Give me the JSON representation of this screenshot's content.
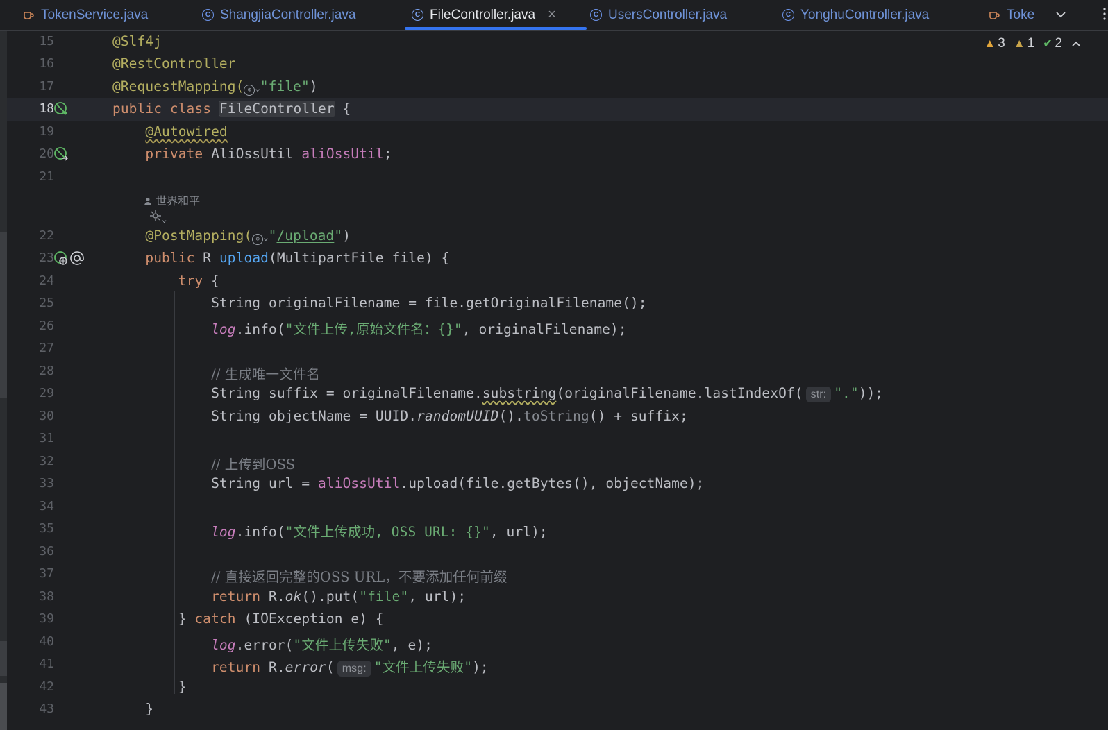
{
  "tabs": [
    {
      "label": "TokenService.java",
      "icon": "java-cup-icon",
      "active": false
    },
    {
      "label": "ShangjiaController.java",
      "icon": "class-c-icon",
      "active": false
    },
    {
      "label": "FileController.java",
      "icon": "class-c-icon",
      "active": true
    },
    {
      "label": "UsersController.java",
      "icon": "class-c-icon",
      "active": false
    },
    {
      "label": "YonghuController.java",
      "icon": "class-c-icon",
      "active": false
    },
    {
      "label": "Toke",
      "icon": "java-cup-icon",
      "active": false
    }
  ],
  "inspections": {
    "warnings": "3",
    "weak_warnings": "1",
    "typos": "2"
  },
  "author_hint": "世界和平",
  "code": {
    "l15": {
      "n": "15",
      "ann": "@Slf4j"
    },
    "l16": {
      "n": "16",
      "ann": "@RestController"
    },
    "l17": {
      "n": "17",
      "ann": "@RequestMapping(",
      "str": "\"file\"",
      "close": ")"
    },
    "l18": {
      "n": "18",
      "kw": "public class ",
      "cls": "FileController",
      "rest": " {"
    },
    "l19": {
      "n": "19",
      "ann": "@Autowired"
    },
    "l20": {
      "n": "20",
      "kw": "private ",
      "type": "AliOssUtil ",
      "field": "aliOssUtil",
      "rest": ";"
    },
    "l21": {
      "n": "21"
    },
    "l22": {
      "n": "22",
      "ann": "@PostMapping(",
      "str_q1": "\"",
      "str_path": "/upload",
      "str_q2": "\"",
      "close": ")"
    },
    "l23": {
      "n": "23",
      "kw": "public ",
      "type": "R ",
      "fn": "upload",
      "rest": "(MultipartFile file) {"
    },
    "l24": {
      "n": "24",
      "kw": "try",
      "rest": " {"
    },
    "l25": {
      "n": "25",
      "text": "String originalFilename = file.getOriginalFilename();"
    },
    "l26": {
      "n": "26",
      "st": "log",
      "pre": ".info(",
      "str": "\"文件上传,原始文件名：{}\"",
      "post": ", originalFilename);"
    },
    "l27": {
      "n": "27"
    },
    "l28": {
      "n": "28",
      "comment": "// 生成唯一文件名"
    },
    "l29": {
      "n": "29",
      "pre": "String suffix = originalFilename.",
      "wavy": "substring",
      "mid": "(originalFilename.lastIndexOf(",
      "hint": "str:",
      "str": "\".\"",
      "post": "));"
    },
    "l30": {
      "n": "30",
      "pre": "String objectName = UUID.",
      "it": "randomUUID",
      "mid": "().",
      "muted": "toString",
      "post": "() + suffix;"
    },
    "l31": {
      "n": "31"
    },
    "l32": {
      "n": "32",
      "comment": "// 上传到OSS"
    },
    "l33": {
      "n": "33",
      "pre": "String url = ",
      "field": "aliOssUtil",
      "post": ".upload(file.getBytes(), objectName);"
    },
    "l34": {
      "n": "34"
    },
    "l35": {
      "n": "35",
      "st": "log",
      "pre": ".info(",
      "str": "\"文件上传成功, OSS URL: {}\"",
      "post": ", url);"
    },
    "l36": {
      "n": "36"
    },
    "l37": {
      "n": "37",
      "comment": "// 直接返回完整的OSS URL，不要添加任何前缀"
    },
    "l38": {
      "n": "38",
      "kw": "return ",
      "pre": "R.",
      "it": "ok",
      "mid": "().put(",
      "str": "\"file\"",
      "post": ", url);"
    },
    "l39": {
      "n": "39",
      "pre": "} ",
      "kw": "catch",
      "post": " (IOException e) {"
    },
    "l40": {
      "n": "40",
      "st": "log",
      "pre": ".error(",
      "str": "\"文件上传失败\"",
      "post": ", e);"
    },
    "l41": {
      "n": "41",
      "kw": "return ",
      "pre": "R.",
      "it": "error",
      "mid": "(",
      "hint": "msg:",
      "str": "\"文件上传失败\"",
      "post": ");"
    },
    "l42": {
      "n": "42",
      "text": "}"
    },
    "l43": {
      "n": "43",
      "text": "}"
    }
  },
  "colors": {
    "background": "#1e1f22",
    "keyword": "#cf8e6d",
    "annotation": "#b3ae60",
    "string": "#6aab73",
    "field": "#c77dbb",
    "method": "#56a8f5",
    "comment": "#7a7e85",
    "active_tab_underline": "#3574f0"
  }
}
